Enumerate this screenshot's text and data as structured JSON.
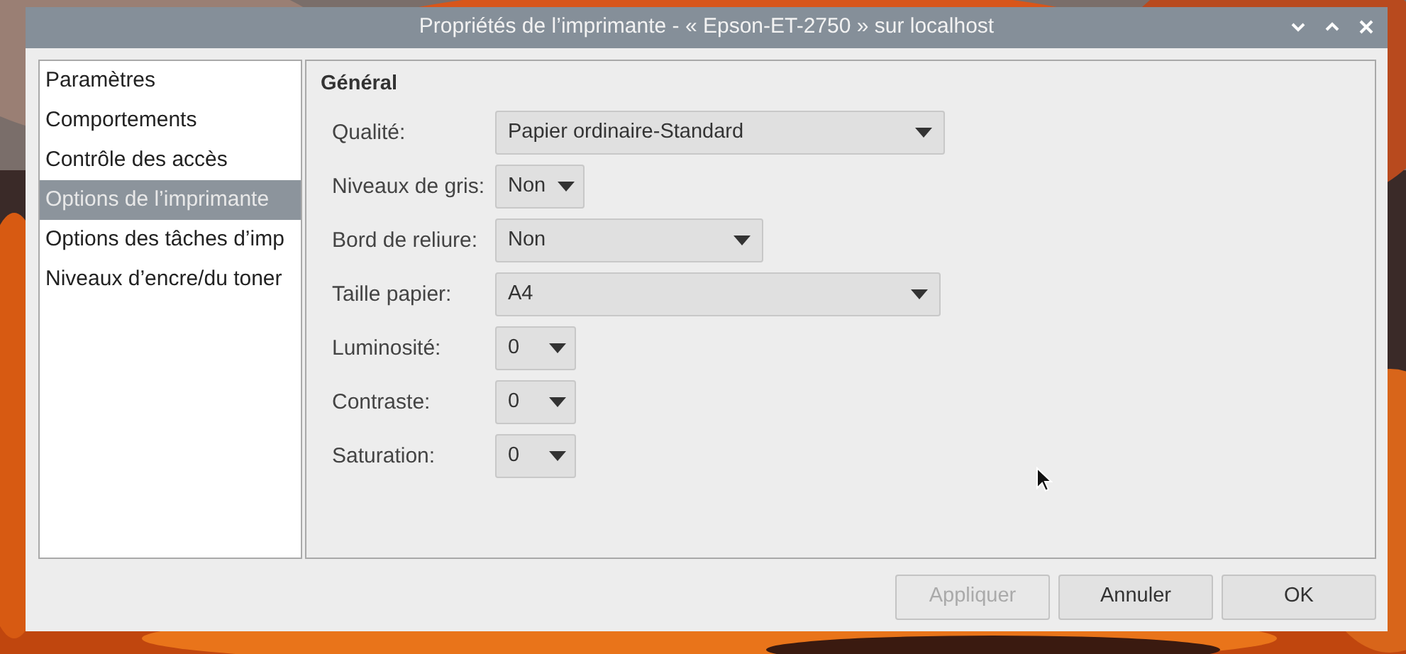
{
  "window": {
    "title": "Propriétés de l’imprimante - « Epson-ET-2750 » sur localhost"
  },
  "sidebar": {
    "items": [
      {
        "label": "Paramètres",
        "selected": false
      },
      {
        "label": "Comportements",
        "selected": false
      },
      {
        "label": "Contrôle des accès",
        "selected": false
      },
      {
        "label": "Options de l’imprimante",
        "selected": true
      },
      {
        "label": "Options des tâches d’imp",
        "selected": false
      },
      {
        "label": "Niveaux d’encre/du toner",
        "selected": false
      }
    ]
  },
  "section": {
    "title": "Général",
    "options": [
      {
        "label": "Qualité:",
        "value": "Papier ordinaire-Standard"
      },
      {
        "label": "Niveaux de gris:",
        "value": "Non"
      },
      {
        "label": "Bord de reliure:",
        "value": "Non"
      },
      {
        "label": "Taille papier:",
        "value": "A4"
      },
      {
        "label": "Luminosité:",
        "value": "0"
      },
      {
        "label": "Contraste:",
        "value": "0"
      },
      {
        "label": "Saturation:",
        "value": "0"
      }
    ]
  },
  "buttons": [
    {
      "label": "Appliquer",
      "disabled": true
    },
    {
      "label": "Annuler",
      "disabled": false
    },
    {
      "label": "OK",
      "disabled": false
    }
  ]
}
